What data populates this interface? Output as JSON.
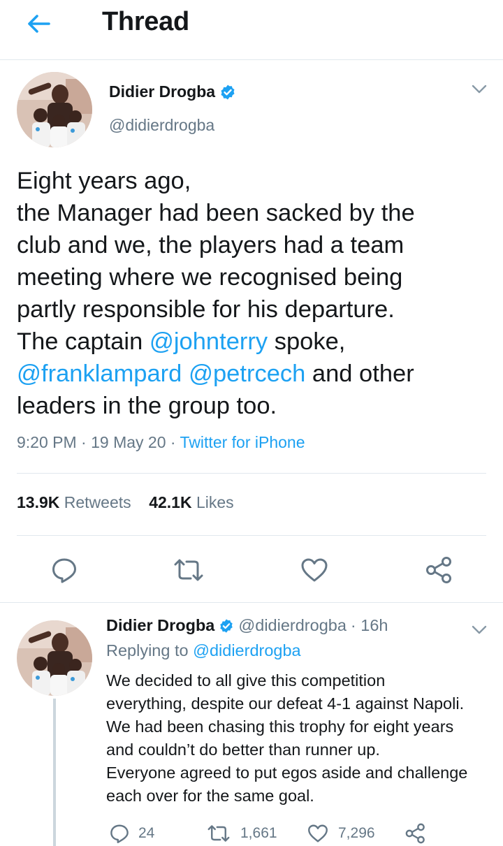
{
  "header": {
    "title": "Thread",
    "back_icon": "arrow-left-icon"
  },
  "colors": {
    "accent": "#1da1f2",
    "text": "#14171a",
    "muted": "#657786",
    "divider": "#e1e8ed"
  },
  "main_tweet": {
    "name": "Didier Drogba",
    "handle": "@didierdrogba",
    "verified": true,
    "lines": {
      "l1": "Eight years ago,",
      "l2": "the Manager had been sacked by the",
      "l3": "club and we, the players had a team",
      "l4": "meeting where we recognised being",
      "l5": "partly responsible for his departure.",
      "l6a": "The captain ",
      "l6b": "@johnterry",
      "l6c": " spoke,",
      "l7a": "@franklampard",
      "l7b": " ",
      "l7c": "@petrcech",
      "l7d": " and other",
      "l8": "leaders in the group too."
    },
    "time": "9:20 PM",
    "date": "19 May 20",
    "separator": " · ",
    "source": "Twitter for iPhone",
    "retweets_count": "13.9K",
    "retweets_label": "Retweets",
    "likes_count": "42.1K",
    "likes_label": "Likes"
  },
  "reply_tweet": {
    "name": "Didier Drogba",
    "handle": "@didierdrogba",
    "time": "· 16h",
    "replying_prefix": "Replying to ",
    "replying_to": "@didierdrogba",
    "lines": {
      "l1": "We decided to all give this competition",
      "l2": "everything, despite our defeat 4-1 against Napoli.",
      "l3": "We had been chasing this trophy for eight years",
      "l4": "and couldn’t do better than runner up.",
      "l5": "Everyone agreed to put egos aside and challenge",
      "l6": "each over for the same goal."
    },
    "replies": "24",
    "retweets": "1,661",
    "likes": "7,296"
  }
}
